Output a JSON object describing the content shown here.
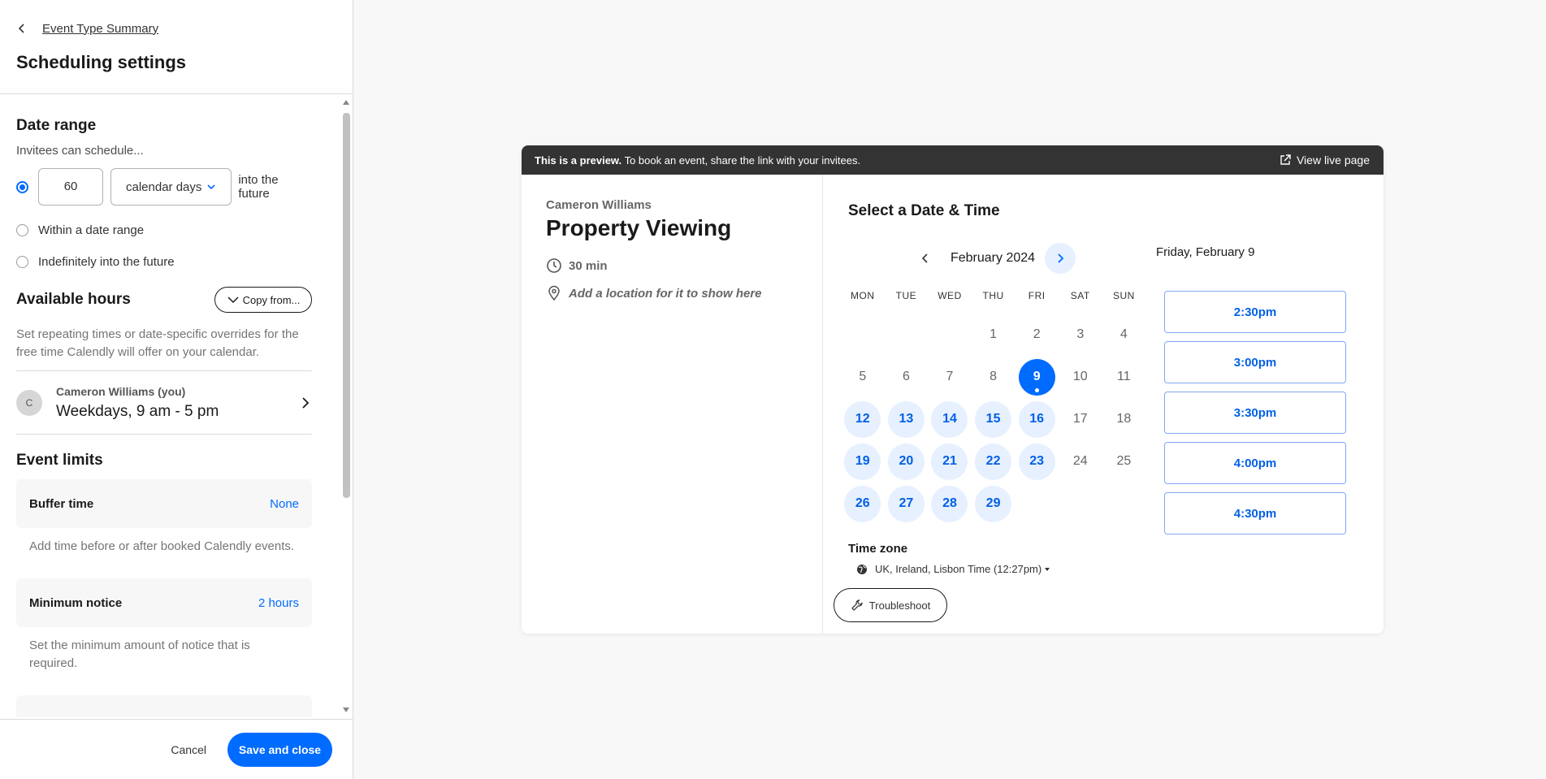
{
  "sidebar": {
    "back_label": "Event Type Summary",
    "title": "Scheduling settings",
    "date_range": {
      "title": "Date range",
      "subtitle": "Invitees can schedule...",
      "days_value": "60",
      "unit": "calendar days",
      "suffix": "into the future",
      "option_within": "Within a date range",
      "option_indefinite": "Indefinitely into the future",
      "selected": "days"
    },
    "available_hours": {
      "title": "Available hours",
      "copy_button": "Copy from...",
      "description": "Set repeating times or date-specific overrides for the free time Calendly will offer on your calendar.",
      "avatar_initial": "C",
      "user": "Cameron Williams (you)",
      "hours": "Weekdays, 9 am - 5 pm"
    },
    "event_limits": {
      "title": "Event limits",
      "items": [
        {
          "name": "Buffer time",
          "value": "None",
          "description": "Add time before or after booked Calendly events."
        },
        {
          "name": "Minimum notice",
          "value": "2 hours",
          "description": "Set the minimum amount of notice that is required."
        }
      ]
    },
    "footer": {
      "cancel": "Cancel",
      "save": "Save and close"
    }
  },
  "preview": {
    "banner_bold": "This is a preview.",
    "banner_text": " To book an event, share the link with your invitees.",
    "view_live": "View live page",
    "host": "Cameron Williams",
    "event_title": "Property Viewing",
    "duration": "30 min",
    "location": "Add a location for it to show here",
    "select_title": "Select a Date & Time",
    "month": "February 2024",
    "weekdays": [
      "MON",
      "TUE",
      "WED",
      "THU",
      "FRI",
      "SAT",
      "SUN"
    ],
    "calendar": {
      "leading_blanks": 3,
      "days": [
        1,
        2,
        3,
        4,
        5,
        6,
        7,
        8,
        9,
        10,
        11,
        12,
        13,
        14,
        15,
        16,
        17,
        18,
        19,
        20,
        21,
        22,
        23,
        24,
        25,
        26,
        27,
        28,
        29
      ],
      "available": [
        12,
        13,
        14,
        15,
        16,
        19,
        20,
        21,
        22,
        23,
        26,
        27,
        28,
        29
      ],
      "selected": 9
    },
    "selected_date_label": "Friday, February 9",
    "time_slots": [
      "2:30pm",
      "3:00pm",
      "3:30pm",
      "4:00pm",
      "4:30pm"
    ],
    "timezone_title": "Time zone",
    "timezone": "UK, Ireland, Lisbon Time (12:27pm)",
    "troubleshoot": "Troubleshoot"
  },
  "colors": {
    "accent": "#006bff",
    "accent_light": "#e6f0ff",
    "banner": "#333333"
  },
  "icons": [
    "chevron-left-icon",
    "chevron-down-icon",
    "chevron-right-icon",
    "clock-icon",
    "location-pin-icon",
    "external-link-icon",
    "globe-icon",
    "wrench-icon"
  ]
}
